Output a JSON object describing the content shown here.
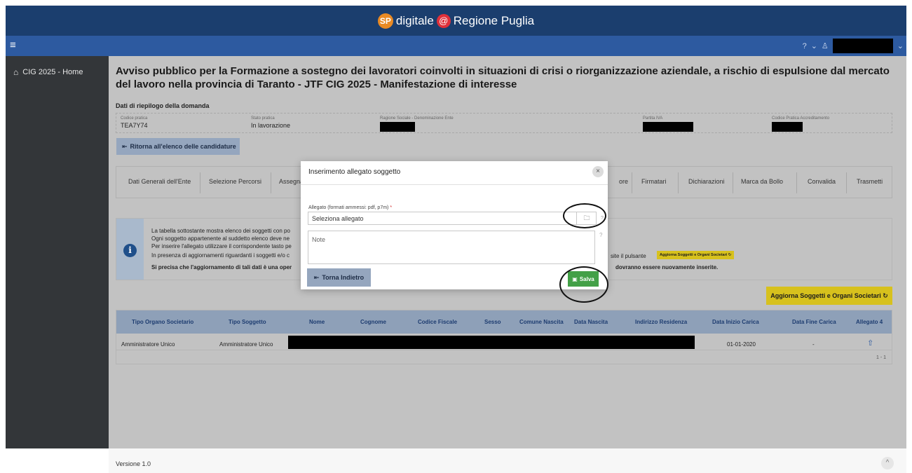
{
  "banner": {
    "logo_text": "SP",
    "text_left": "digitale",
    "at_symbol": "@",
    "text_right": "Regione Puglia"
  },
  "navbar": {
    "menu_icon": "hamburger-icon",
    "help_icon": "help-icon",
    "user_icon": "user-icon",
    "chevron": "⌄"
  },
  "sidebar": {
    "items": [
      {
        "icon": "home-icon",
        "label": "CIG 2025 - Home"
      }
    ]
  },
  "page": {
    "title": "Avviso pubblico per la Formazione a sostegno dei lavoratori coinvolti in situazioni di crisi o riorganizzazione aziendale, a rischio di espulsione dal mercato del lavoro nella provincia di Taranto - JTF CIG 2025 - Manifestazione di interesse"
  },
  "riepilogo": {
    "heading": "Dati di riepilogo della domanda",
    "codice_label": "Codice pratica",
    "codice_value": "TEA7Y74",
    "stato_label": "Stato pratica",
    "stato_value": "In lavorazione",
    "ragione_label": "Ragione Sociale - Denominazione Ente",
    "piva_label": "Partita IVA",
    "accred_label": "Codice Pratica Accreditamento"
  },
  "back_list_button": "Ritorna all'elenco delle candidature",
  "tabs": [
    "Dati Generali dell'Ente",
    "Selezione Percorsi",
    "Assegna",
    "ore",
    "Firmatari",
    "Dichiarazioni",
    "Marca da Bollo",
    "Convalida",
    "Trasmetti"
  ],
  "info": {
    "line1": "La tabella sottostante mostra elenco dei soggetti con po",
    "line2": "Ogni soggetto appartenente al suddetto elenco deve ne",
    "line3": "Per inserire l'allegato utilizzare il corrispondente tasto pe",
    "line4": "In presenza di aggiornamenti riguardanti i soggetti e/o c",
    "line4_right": "site il pulsante",
    "mini_button": "Aggiorna Soggetti e Organi Societari ↻",
    "line5": "Si precisa che l'aggiornamento di tali dati è una oper",
    "line5_right": "dovranno essere nuovamente inserite."
  },
  "aggiorna_button": "Aggiorna Soggetti e Organi Societari ↻",
  "table": {
    "headers": [
      "Tipo Organo Societario",
      "Tipo Soggetto",
      "Nome",
      "Cognome",
      "Codice Fiscale",
      "Sesso",
      "Comune Nascita",
      "Data Nascita",
      "Indirizzo Residenza",
      "Data Inizio Carica",
      "Data Fine Carica",
      "Allegato 4"
    ],
    "rows": [
      {
        "tipo_organo": "Amministratore Unico",
        "tipo_soggetto": "Amministratore Unico",
        "data_inizio": "01-01-2020",
        "data_fine": "-",
        "allegato_icon": "upload-icon"
      }
    ],
    "pager": "1 - 1"
  },
  "modal": {
    "title": "Inserimento allegato soggetto",
    "close": "×",
    "file_label": "Allegato (formati ammessi: pdf, p7m)",
    "required_mark": "*",
    "file_placeholder": "Seleziona allegato",
    "browse_icon": "folder-icon",
    "note_placeholder": "Note",
    "back_button": "Torna Indietro",
    "save_button": "Salva"
  },
  "footer": {
    "version": "Versione 1.0",
    "up": "^"
  }
}
